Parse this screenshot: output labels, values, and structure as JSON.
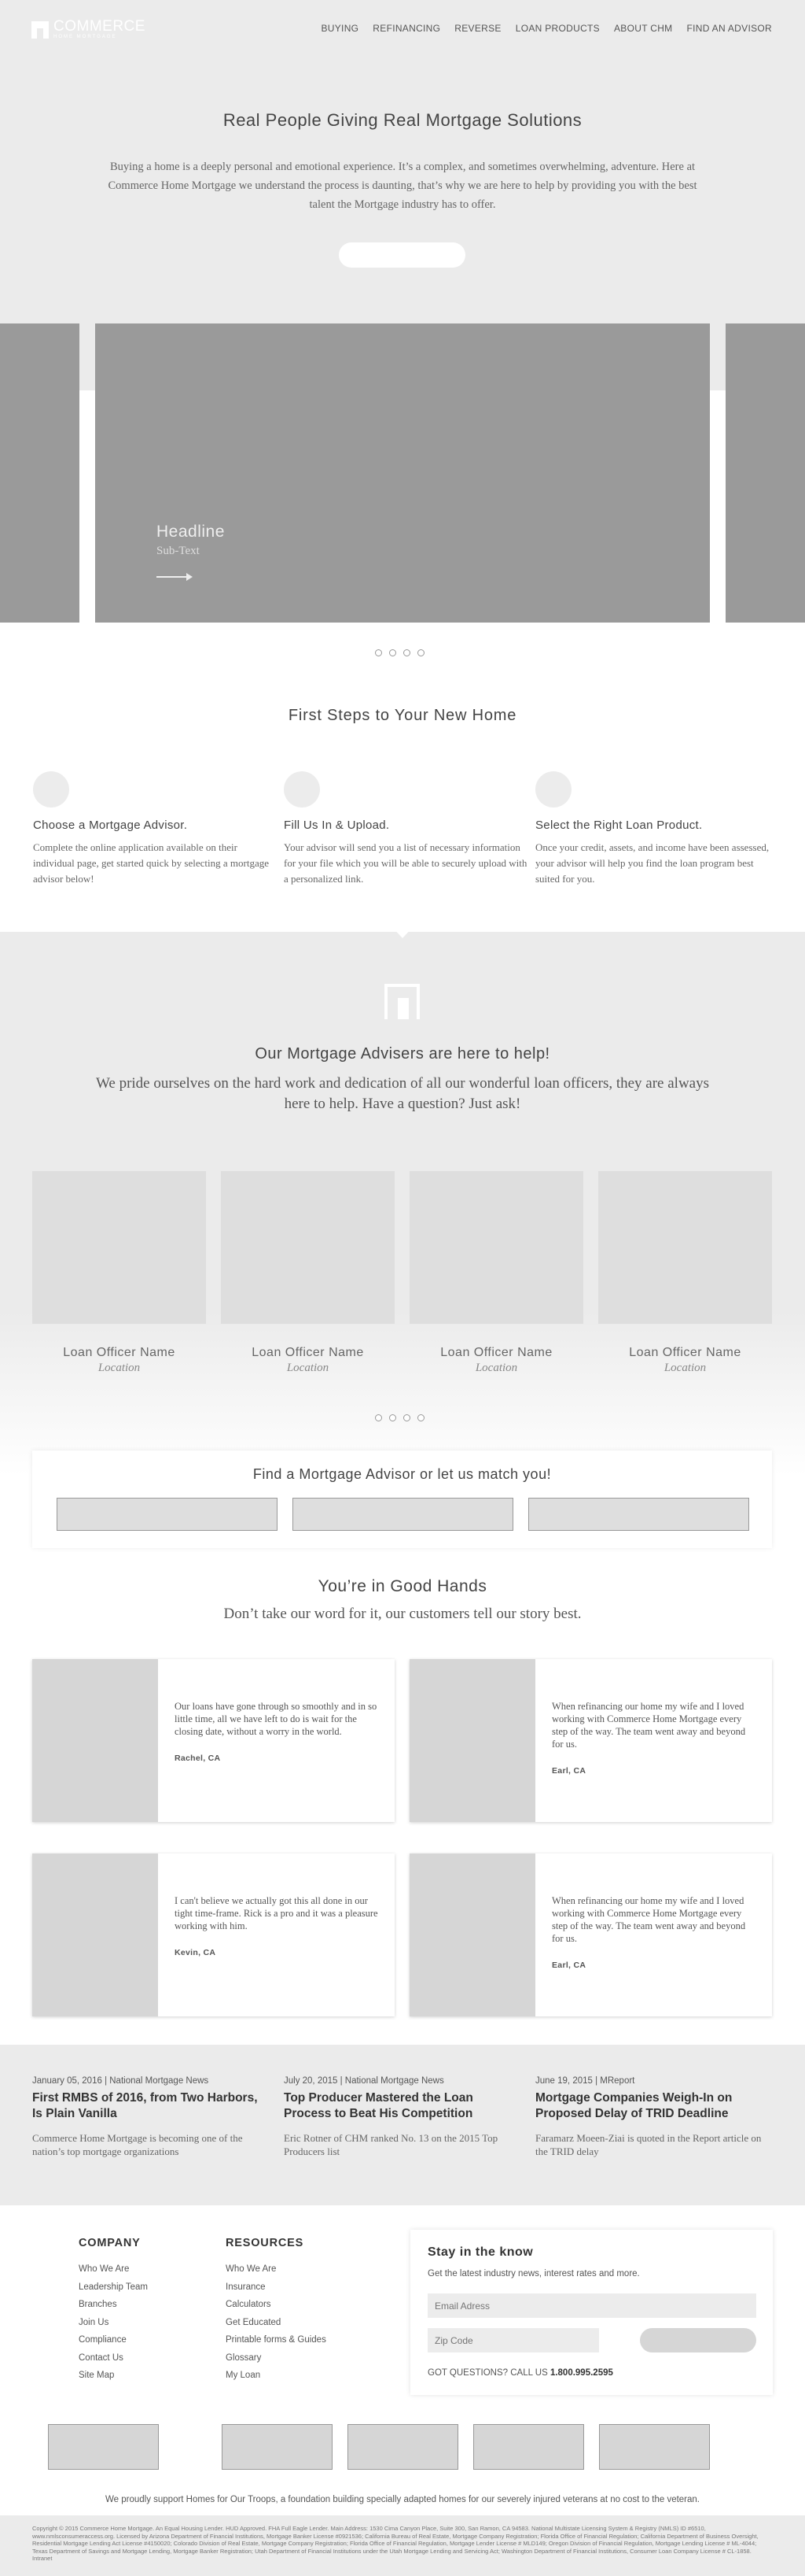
{
  "header": {
    "logo_text": "COMMERCE",
    "logo_sub": "HOME MORTGAGE",
    "nav": [
      "BUYING",
      "REFINANCING",
      "REVERSE",
      "LOAN PRODUCTS",
      "ABOUT CHM",
      "FIND AN ADVISOR"
    ]
  },
  "hero": {
    "title": "Real People Giving Real Mortgage Solutions",
    "body": "Buying a home is a deeply personal and emotional experience. It’s a complex, and sometimes overwhelming, adventure. Here at Commerce Home Mortgage we understand the process is daunting, that’s why we are here to help by providing you with the best talent the Mortgage industry has to offer."
  },
  "carousel": {
    "headline": "Headline",
    "subtext": "Sub-Text"
  },
  "steps": {
    "title": "First Steps to Your New Home",
    "items": [
      {
        "title": "Choose a Mortgage Advisor.",
        "body": "Complete the online application available on their individual page, get started quick by selecting a mortgage advisor below!"
      },
      {
        "title": "Fill Us In & Upload.",
        "body": "Your advisor will send you a list of necessary information for your file which you will be able to securely upload with a personalized link."
      },
      {
        "title": "Select the Right Loan Product.",
        "body": "Once your credit, assets, and income have been assessed, your advisor will help you find the loan program best suited for you."
      }
    ]
  },
  "advisers": {
    "title": "Our Mortgage Advisers are here to help!",
    "body": "We pride ourselves on the hard work and dedication of all our wonderful loan officers, they are always here to help. Have a question? Just ask!",
    "officers": [
      {
        "name": "Loan Officer Name",
        "location": "Location"
      },
      {
        "name": "Loan Officer Name",
        "location": "Location"
      },
      {
        "name": "Loan Officer Name",
        "location": "Location"
      },
      {
        "name": "Loan Officer Name",
        "location": "Location"
      }
    ]
  },
  "match": {
    "title": "Find a Mortgage Advisor or let us match you!"
  },
  "testimonials": {
    "title": "You’re in Good Hands",
    "subtitle": "Don’t take our word for it, our customers tell our story best.",
    "items": [
      {
        "quote": "Our loans have gone through so smoothly and in so little time, all we have left to do is wait for the closing date, without a worry in the world.",
        "author": "Rachel, CA"
      },
      {
        "quote": "When refinancing our home my wife and I loved working with Commerce Home Mortgage every step of the way. The team went away and beyond for us.",
        "author": "Earl, CA"
      },
      {
        "quote": "I can't believe we actually got this all done in our tight time-frame. Rick is a pro and it was a pleasure working with him.",
        "author": "Kevin, CA"
      },
      {
        "quote": "When refinancing our home my wife and I loved working with Commerce Home Mortgage every step of the way. The team went away and beyond for us.",
        "author": "Earl, CA"
      }
    ]
  },
  "news": [
    {
      "meta": "January 05, 2016 | National Mortgage News",
      "title": "First RMBS of 2016, from Two Harbors, Is Plain Vanilla",
      "body": "Commerce Home Mortgage is becoming one of the nation’s top mortgage organizations"
    },
    {
      "meta": "July 20, 2015 | National Mortgage News",
      "title": "Top Producer Mastered the Loan Process to Beat His Competition",
      "body": "Eric Rotner of CHM ranked No. 13 on the 2015 Top Producers list"
    },
    {
      "meta": "June 19, 2015 | MReport",
      "title": "Mortgage Companies Weigh-In on Proposed Delay of TRID Deadline",
      "body": "Faramarz Moeen-Ziai is quoted in the Report article on the TRID delay"
    }
  ],
  "footer": {
    "company_title": "COMPANY",
    "company": [
      "Who We Are",
      "Leadership Team",
      "Branches",
      "Join Us",
      "Compliance",
      "Contact Us",
      "Site Map"
    ],
    "resources_title": "RESOURCES",
    "resources": [
      "Who We Are",
      "Insurance",
      "Calculators",
      "Get Educated",
      "Printable forms & Guides",
      "Glossary",
      "My Loan"
    ],
    "stay_title": "Stay in the know",
    "stay_lead": "Get the latest industry news, interest rates and more.",
    "email_ph": "Email Adress",
    "zip_ph": "Zip Code",
    "questions": "GOT QUESTIONS? CALL US",
    "phone": "1.800.995.2595",
    "support": "We proudly support Homes for Our Troops, a foundation building specially adapted homes for our severely injured veterans at no cost to the veteran.",
    "legal": "Copyright © 2015 Commerce Home Mortgage. An Equal Housing Lender. HUD Approved. FHA Full Eagle Lender. Main Address: 1530 Cima Canyon Place, Suite 300, San Ramon, CA 94583. National Multistate Licensing System & Registry (NMLS) ID #6510, www.nmlsconsumeraccess.org. Licensed by Arizona Department of Financial Institutions, Mortgage Banker License #0921536; California Bureau of Real Estate, Mortgage Company Registration; Florida Office of Financial Regulation; California Department of Business Oversight, Residential Mortgage Lending Act License #4150020; Colorado Division of Real Estate, Mortgage Company Registration; Florida Office of Financial Regulation, Mortgage Lender License # MLD149; Oregon Division of Financial Regulation, Mortgage Lending License # ML-4044; Texas Department of Savings and Mortgage Lending, Mortgage Banker Registration; Utah Department of Financial Institutions under the Utah Mortgage Lending and Servicing Act; Washington Department of Financial Institutions, Consumer Loan Company License # CL-1858. Intranet"
  }
}
